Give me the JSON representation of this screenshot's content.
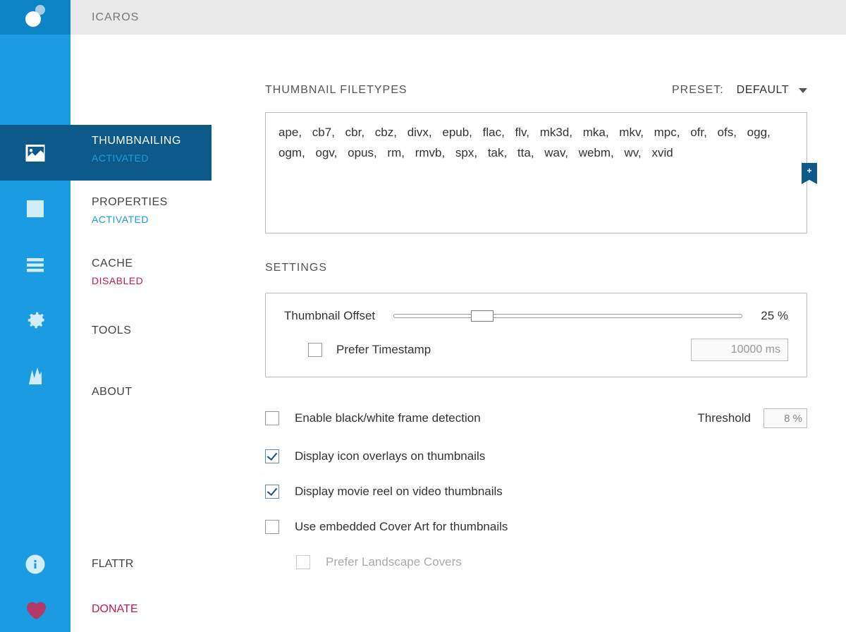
{
  "app_title": "ICAROS",
  "nav": {
    "thumbnailing": {
      "label": "THUMBNAILING",
      "status": "ACTIVATED"
    },
    "properties": {
      "label": "PROPERTIES",
      "status": "ACTIVATED"
    },
    "cache": {
      "label": "CACHE",
      "status": "DISABLED"
    },
    "tools": {
      "label": "TOOLS"
    },
    "about": {
      "label": "ABOUT"
    },
    "flattr": {
      "label": "FLATTR"
    },
    "donate": {
      "label": "DONATE"
    }
  },
  "section": {
    "filetypes_heading": "THUMBNAIL FILETYPES",
    "preset_label": "PRESET:",
    "preset_value": "DEFAULT",
    "filetypes_text": "ape, cb7, cbr, cbz, divx, epub, flac, flv, mk3d, mka, mkv, mpc, ofr, ofs, ogg, ogm, ogv, opus, rm, rmvb, spx, tak, tta, wav, webm, wv, xvid",
    "settings_heading": "SETTINGS"
  },
  "offset": {
    "label": "Thumbnail Offset",
    "value_text": "25 %",
    "prefer_timestamp_label": "Prefer Timestamp",
    "timestamp_value": "10000 ms"
  },
  "options": {
    "bw_detect": "Enable black/white frame detection",
    "threshold_label": "Threshold",
    "threshold_value": "8 %",
    "icon_overlays": "Display icon overlays on thumbnails",
    "movie_reel": "Display movie reel on video thumbnails",
    "cover_art": "Use embedded Cover Art for thumbnails",
    "landscape": "Prefer Landscape Covers"
  }
}
